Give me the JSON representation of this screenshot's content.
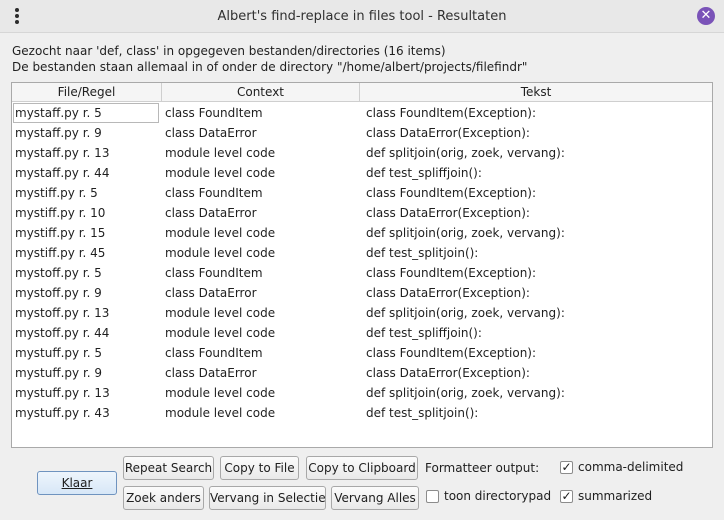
{
  "window": {
    "title": "Albert's find-replace in files tool - Resultaten",
    "close_glyph": "✕"
  },
  "info": {
    "line1": "Gezocht naar 'def, class' in opgegeven bestanden/directories (16 items)",
    "line2": "De bestanden staan allemaal in of onder de directory \"/home/albert/projects/filefindr\""
  },
  "table": {
    "columns": [
      "File/Regel",
      "Context",
      "Tekst"
    ],
    "rows": [
      [
        "mystaff.py r. 5",
        "class FoundItem",
        "class FoundItem(Exception):"
      ],
      [
        "mystaff.py r. 9",
        "class DataError",
        "class DataError(Exception):"
      ],
      [
        "mystaff.py r. 13",
        "module level code",
        "def splitjoin(orig, zoek, vervang):"
      ],
      [
        "mystaff.py r. 44",
        "module level code",
        "def test_spliffjoin():"
      ],
      [
        "mystiff.py r. 5",
        "class FoundItem",
        "class FoundItem(Exception):"
      ],
      [
        "mystiff.py r. 10",
        "class DataError",
        "class DataError(Exception):"
      ],
      [
        "mystiff.py r. 15",
        "module level code",
        "def splitjoin(orig, zoek, vervang):"
      ],
      [
        "mystiff.py r. 45",
        "module level code",
        "def test_splitjoin():"
      ],
      [
        "mystoff.py r. 5",
        "class FoundItem",
        "class FoundItem(Exception):"
      ],
      [
        "mystoff.py r. 9",
        "class DataError",
        "class DataError(Exception):"
      ],
      [
        "mystoff.py r. 13",
        "module level code",
        "def splitjoin(orig, zoek, vervang):"
      ],
      [
        "mystoff.py r. 44",
        "module level code",
        "def test_spliffjoin():"
      ],
      [
        "mystuff.py r. 5",
        "class FoundItem",
        "class FoundItem(Exception):"
      ],
      [
        "mystuff.py r. 9",
        "class DataError",
        "class DataError(Exception):"
      ],
      [
        "mystuff.py r. 13",
        "module level code",
        "def splitjoin(orig, zoek, vervang):"
      ],
      [
        "mystuff.py r. 43",
        "module level code",
        "def test_splitjoin():"
      ]
    ]
  },
  "buttons": {
    "klaar": "Klaar",
    "repeat_search": "Repeat Search",
    "copy_to_file": "Copy to File",
    "copy_to_clipboard": "Copy to Clipboard",
    "zoek_anders": "Zoek anders",
    "vervang_in_selectie": "Vervang in Selectie",
    "vervang_alles": "Vervang Alles"
  },
  "options": {
    "format_label": "Formatteer output:",
    "comma_delimited": {
      "label": "comma-delimited",
      "checked": true
    },
    "toon_directorypad": {
      "label": "toon directorypad",
      "checked": false
    },
    "summarized": {
      "label": "summarized",
      "checked": true
    }
  }
}
